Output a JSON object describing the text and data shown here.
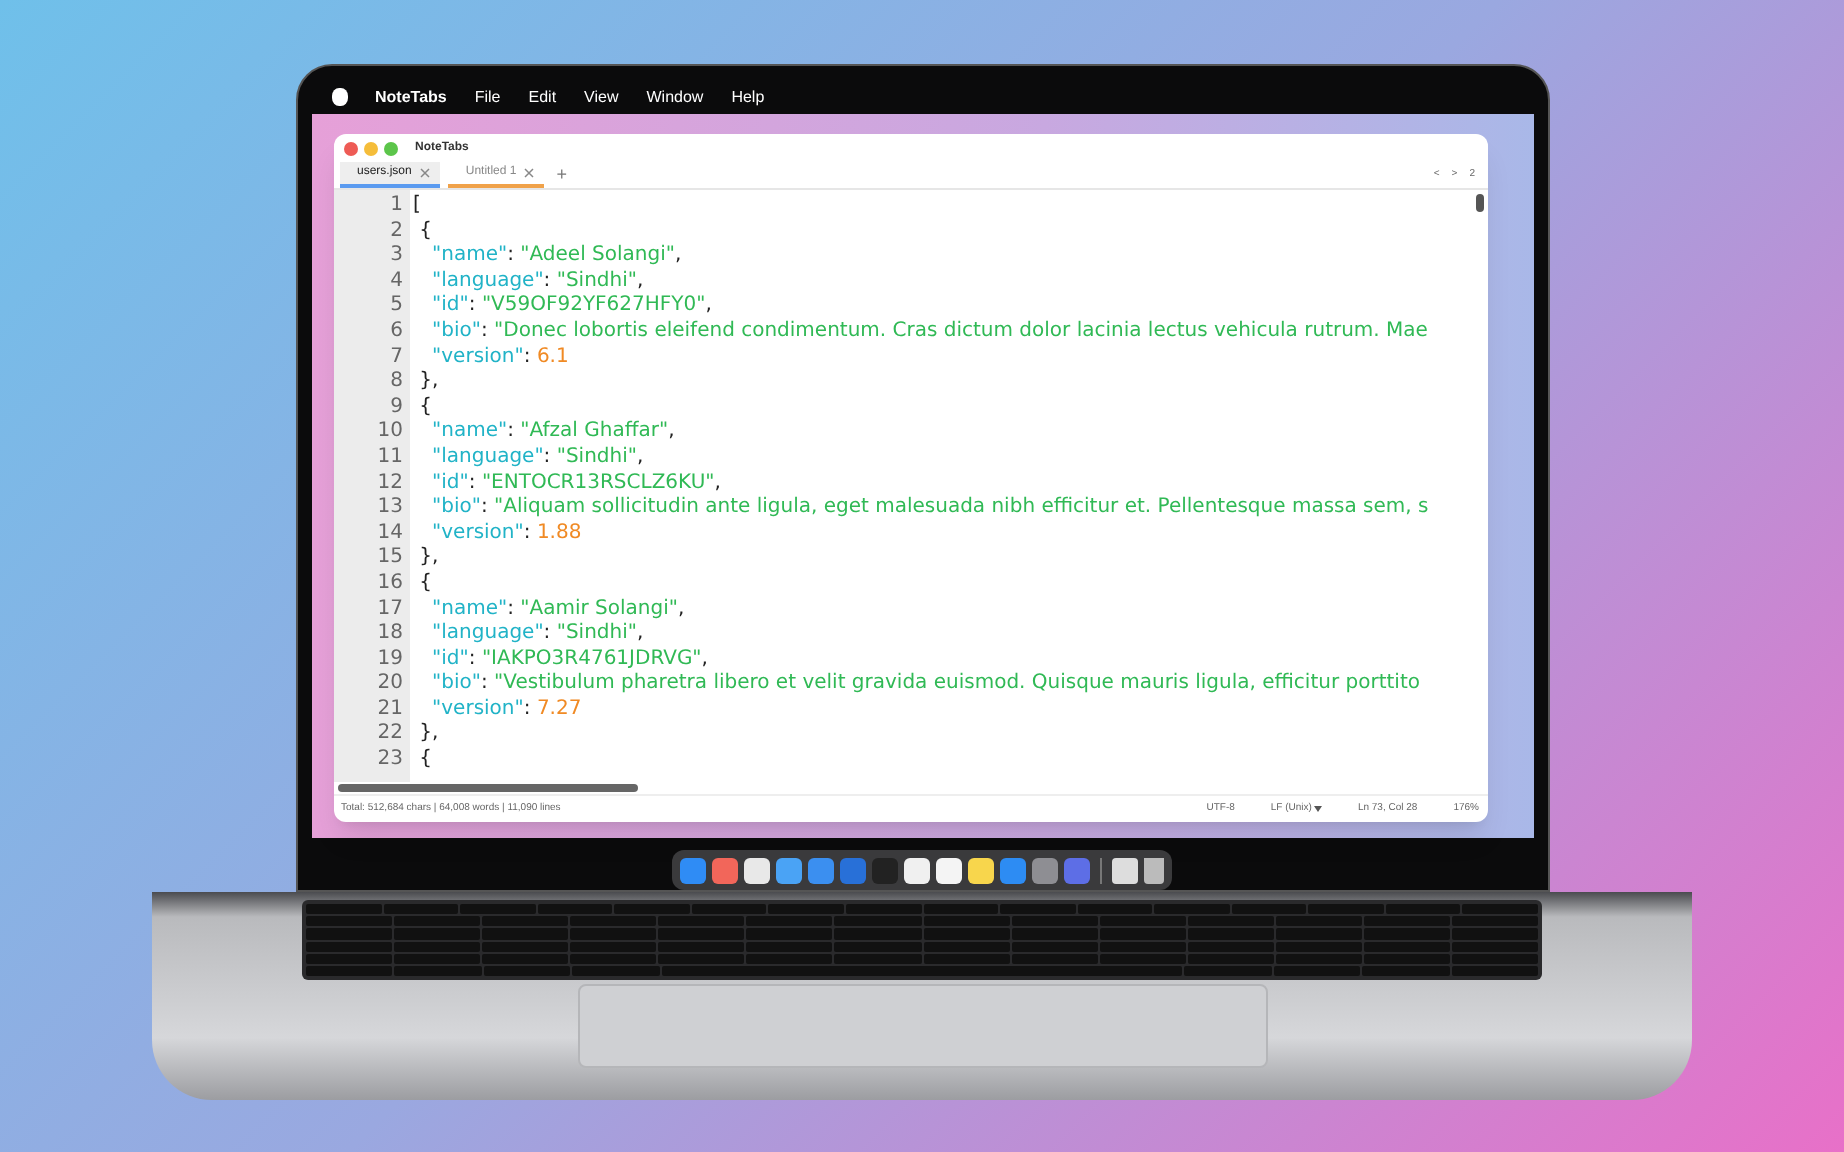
{
  "menu_bar": {
    "app_name": "NoteTabs",
    "items": [
      "File",
      "Edit",
      "View",
      "Window",
      "Help"
    ]
  },
  "window": {
    "title": "NoteTabs"
  },
  "tabs": [
    {
      "label": "users.json",
      "selected": true,
      "color": "#5b9bf0"
    },
    {
      "label": "Untitled 1",
      "selected": false,
      "color": "#f0a24a"
    }
  ],
  "new_tab": "+",
  "tab_nav": [
    "<",
    ">",
    "2"
  ],
  "editor": {
    "lines": [
      {
        "number": "1",
        "tokens": [
          {
            "kind": "punct",
            "text": "["
          }
        ]
      },
      {
        "number": "2",
        "tokens": [
          {
            "kind": "punct",
            "text": " {"
          }
        ]
      },
      {
        "number": "3",
        "tokens": [
          {
            "kind": "key",
            "text": "   \"name\""
          },
          {
            "kind": "punct",
            "text": ": "
          },
          {
            "kind": "string",
            "text": "\"Adeel Solangi\""
          },
          {
            "kind": "punct",
            "text": ","
          }
        ]
      },
      {
        "number": "4",
        "tokens": [
          {
            "kind": "key",
            "text": "   \"language\""
          },
          {
            "kind": "punct",
            "text": ": "
          },
          {
            "kind": "string",
            "text": "\"Sindhi\""
          },
          {
            "kind": "punct",
            "text": ","
          }
        ]
      },
      {
        "number": "5",
        "tokens": [
          {
            "kind": "key",
            "text": "   \"id\""
          },
          {
            "kind": "punct",
            "text": ": "
          },
          {
            "kind": "string",
            "text": "\"V59OF92YF627HFY0\""
          },
          {
            "kind": "punct",
            "text": ","
          }
        ]
      },
      {
        "number": "6",
        "tokens": [
          {
            "kind": "key",
            "text": "   \"bio\""
          },
          {
            "kind": "punct",
            "text": ": "
          },
          {
            "kind": "string",
            "text": "\"Donec lobortis eleifend condimentum. Cras dictum dolor lacinia lectus vehicula rutrum. Mae"
          }
        ]
      },
      {
        "number": "7",
        "tokens": [
          {
            "kind": "key",
            "text": "   \"version\""
          },
          {
            "kind": "punct",
            "text": ": "
          },
          {
            "kind": "number",
            "text": "6.1"
          }
        ]
      },
      {
        "number": "8",
        "tokens": [
          {
            "kind": "punct",
            "text": " },"
          }
        ]
      },
      {
        "number": "9",
        "tokens": [
          {
            "kind": "punct",
            "text": " {"
          }
        ]
      },
      {
        "number": "10",
        "tokens": [
          {
            "kind": "key",
            "text": "   \"name\""
          },
          {
            "kind": "punct",
            "text": ": "
          },
          {
            "kind": "string",
            "text": "\"Afzal Ghaffar\""
          },
          {
            "kind": "punct",
            "text": ","
          }
        ]
      },
      {
        "number": "11",
        "tokens": [
          {
            "kind": "key",
            "text": "   \"language\""
          },
          {
            "kind": "punct",
            "text": ": "
          },
          {
            "kind": "string",
            "text": "\"Sindhi\""
          },
          {
            "kind": "punct",
            "text": ","
          }
        ]
      },
      {
        "number": "12",
        "tokens": [
          {
            "kind": "key",
            "text": "   \"id\""
          },
          {
            "kind": "punct",
            "text": ": "
          },
          {
            "kind": "string",
            "text": "\"ENTOCR13RSCLZ6KU\""
          },
          {
            "kind": "punct",
            "text": ","
          }
        ]
      },
      {
        "number": "13",
        "tokens": [
          {
            "kind": "key",
            "text": "   \"bio\""
          },
          {
            "kind": "punct",
            "text": ": "
          },
          {
            "kind": "string",
            "text": "\"Aliquam sollicitudin ante ligula, eget malesuada nibh efficitur et. Pellentesque massa sem, s"
          }
        ]
      },
      {
        "number": "14",
        "tokens": [
          {
            "kind": "key",
            "text": "   \"version\""
          },
          {
            "kind": "punct",
            "text": ": "
          },
          {
            "kind": "number",
            "text": "1.88"
          }
        ]
      },
      {
        "number": "15",
        "tokens": [
          {
            "kind": "punct",
            "text": " },"
          }
        ]
      },
      {
        "number": "16",
        "tokens": [
          {
            "kind": "punct",
            "text": " {"
          }
        ]
      },
      {
        "number": "17",
        "tokens": [
          {
            "kind": "key",
            "text": "   \"name\""
          },
          {
            "kind": "punct",
            "text": ": "
          },
          {
            "kind": "string",
            "text": "\"Aamir Solangi\""
          },
          {
            "kind": "punct",
            "text": ","
          }
        ]
      },
      {
        "number": "18",
        "tokens": [
          {
            "kind": "key",
            "text": "   \"language\""
          },
          {
            "kind": "punct",
            "text": ": "
          },
          {
            "kind": "string",
            "text": "\"Sindhi\""
          },
          {
            "kind": "punct",
            "text": ","
          }
        ]
      },
      {
        "number": "19",
        "tokens": [
          {
            "kind": "key",
            "text": "   \"id\""
          },
          {
            "kind": "punct",
            "text": ": "
          },
          {
            "kind": "string",
            "text": "\"IAKPO3R4761JDRVG\""
          },
          {
            "kind": "punct",
            "text": ","
          }
        ]
      },
      {
        "number": "20",
        "tokens": [
          {
            "kind": "key",
            "text": "   \"bio\""
          },
          {
            "kind": "punct",
            "text": ": "
          },
          {
            "kind": "string",
            "text": "\"Vestibulum pharetra libero et velit gravida euismod. Quisque mauris ligula, efficitur porttito"
          }
        ]
      },
      {
        "number": "21",
        "tokens": [
          {
            "kind": "key",
            "text": "   \"version\""
          },
          {
            "kind": "punct",
            "text": ": "
          },
          {
            "kind": "number",
            "text": "7.27"
          }
        ]
      },
      {
        "number": "22",
        "tokens": [
          {
            "kind": "punct",
            "text": " },"
          }
        ]
      },
      {
        "number": "23",
        "tokens": [
          {
            "kind": "punct",
            "text": " {"
          }
        ]
      }
    ]
  },
  "status_bar": {
    "summary": "Total: 512,684 chars | 64,008 words | 11,090 lines",
    "encoding": "UTF-8",
    "line_ending": "LF (Unix)",
    "position": "Ln 73, Col 28",
    "zoom": "176%"
  }
}
